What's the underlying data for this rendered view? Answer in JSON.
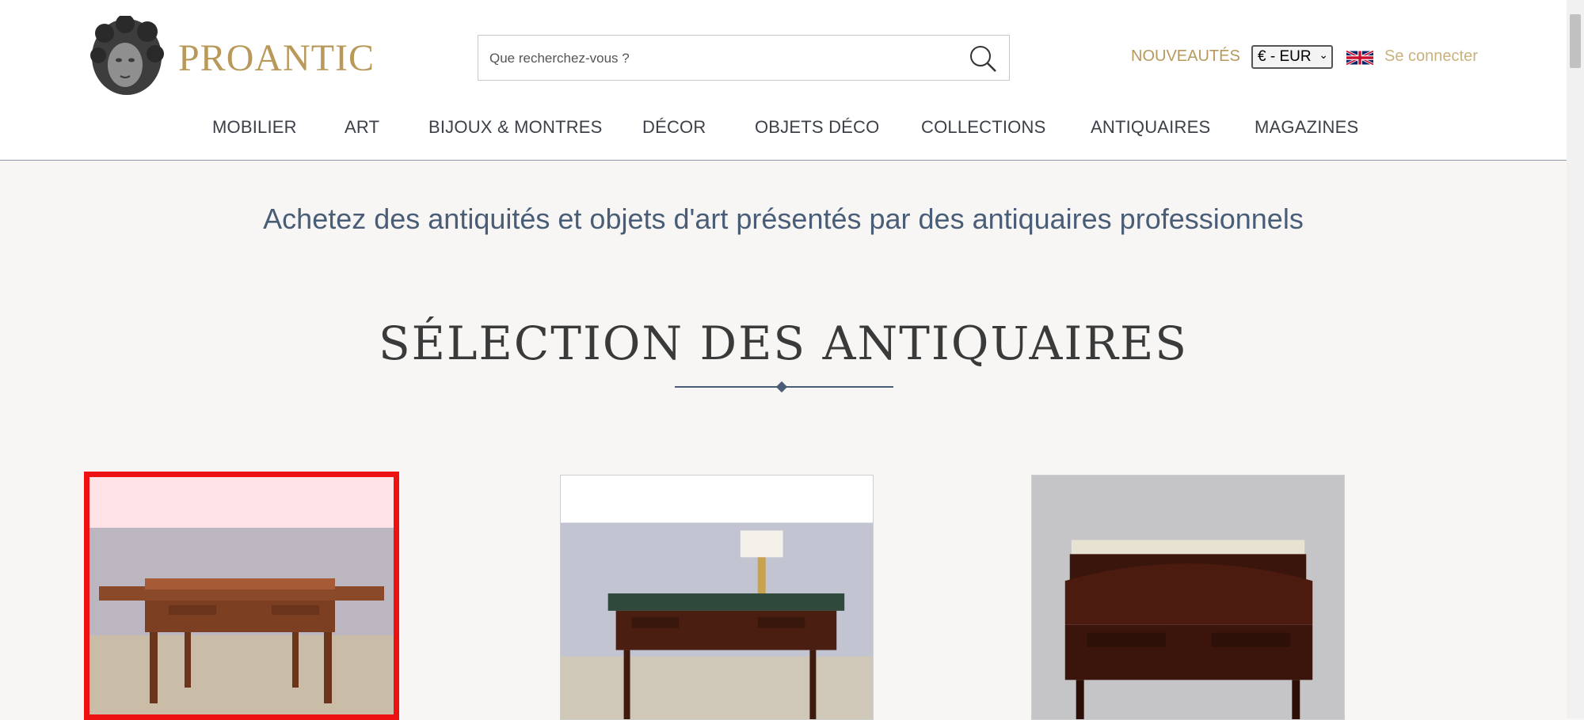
{
  "header": {
    "logo_text": "PROANTIC",
    "search": {
      "placeholder": "Que recherchez-vous ?"
    },
    "new_label": "NOUVEAUTÉS",
    "currency": "€ - EUR",
    "login_label": "Se connecter",
    "nav": [
      "MOBILIER",
      "ART",
      "BIJOUX & MONTRES",
      "DÉCOR",
      "OBJETS DÉCO",
      "COLLECTIONS",
      "ANTIQUAIRES",
      "MAGAZINES"
    ]
  },
  "main": {
    "tagline": "Achetez des antiquités et objets d'art présentés par des antiquaires professionnels",
    "section_title": "SÉLECTION DES ANTIQUAIRES"
  },
  "colors": {
    "brand_gold": "#b8995a",
    "accent_blue": "#4a5d77",
    "selection_red": "#ee1111"
  }
}
